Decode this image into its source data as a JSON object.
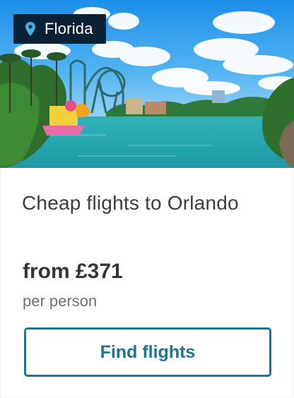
{
  "badge": {
    "icon": "location-pin-icon",
    "label": "Florida"
  },
  "card": {
    "title": "Cheap flights to Orlando",
    "price": "from £371",
    "price_note": "per person",
    "cta_label": "Find flights"
  },
  "colors": {
    "badge_bg": "#0b2236",
    "pin": "#3fb0e0",
    "button_accent": "#1f7394",
    "title_text": "#3a3d40",
    "muted_text": "#6d7175"
  }
}
